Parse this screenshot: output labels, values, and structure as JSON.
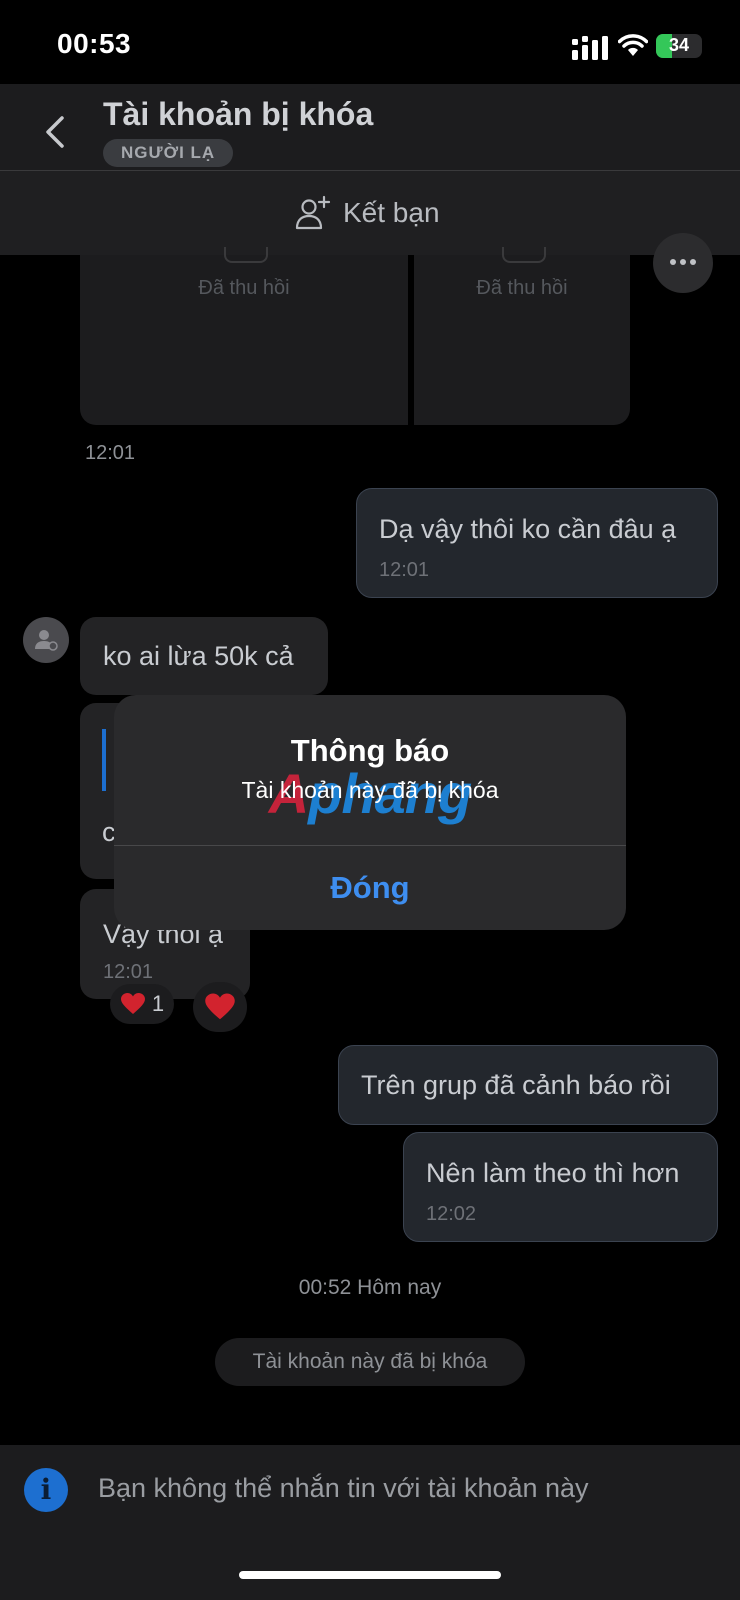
{
  "status_bar": {
    "time": "00:53",
    "battery": "34"
  },
  "header": {
    "title": "Tài khoản bị khóa",
    "badge": "NGƯỜI LẠ"
  },
  "add_friend": {
    "label": "Kết bạn"
  },
  "recalled": {
    "label_1": "Đã thu hồi",
    "label_2": "Đã thu hồi",
    "time": "12:01"
  },
  "messages": [
    {
      "text": "Dạ vậy thôi ko cần đâu ạ",
      "time": "12:01"
    },
    {
      "text": "ko ai lừa 50k cả"
    },
    {
      "text": "Vậy thôi ạ",
      "time": "12:01",
      "reaction_count": "1"
    },
    {
      "text": "Trên grup đã cảnh báo rồi"
    },
    {
      "text": "Nên làm theo thì hơn",
      "time": "12:02"
    }
  ],
  "partial_quote_char": "c",
  "date_separator": "00:52 Hôm nay",
  "system_message": "Tài khoản này đã bị khóa",
  "footer": {
    "text": "Bạn không thể nhắn tin với tài khoản này",
    "icon": "i"
  },
  "dialog": {
    "title": "Thông báo",
    "message": "Tài khoản này đã bị khóa",
    "button": "Đóng",
    "watermark_first": "A",
    "watermark_rest": "phang"
  },
  "colors": {
    "accent": "#3e8ef0",
    "battery": "#34c759",
    "info": "#1d6fd0"
  }
}
